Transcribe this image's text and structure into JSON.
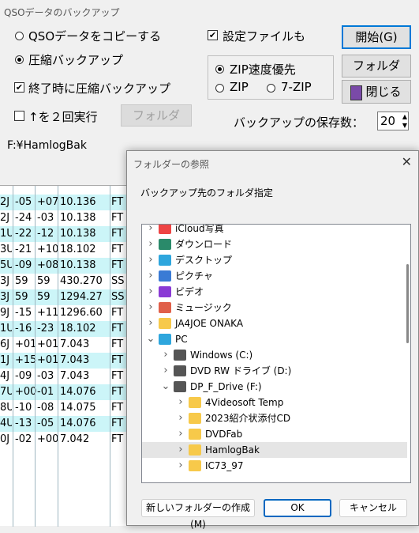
{
  "background_rows": [
    {
      "c1": "2J",
      "c2": "-05",
      "c3": "+07",
      "c4": "10.136",
      "c5": "FT"
    },
    {
      "c1": "2J",
      "c2": "-24",
      "c3": "-03",
      "c4": "10.138",
      "c5": "FT"
    },
    {
      "c1": "1U",
      "c2": "-22",
      "c3": "-12",
      "c4": "10.138",
      "c5": "FT"
    },
    {
      "c1": "3U",
      "c2": "-21",
      "c3": "+10",
      "c4": "18.102",
      "c5": "FT"
    },
    {
      "c1": "5U",
      "c2": "-09",
      "c3": "+08",
      "c4": "10.138",
      "c5": "FT"
    },
    {
      "c1": "3J",
      "c2": "59",
      "c3": "59",
      "c4": "430.270",
      "c5": "SS"
    },
    {
      "c1": "3J",
      "c2": "59",
      "c3": "59",
      "c4": "1294.27",
      "c5": "SS"
    },
    {
      "c1": "9J",
      "c2": "-15",
      "c3": "+11",
      "c4": "1296.60",
      "c5": "FT"
    },
    {
      "c1": "1U",
      "c2": "-16",
      "c3": "-23",
      "c4": "18.102",
      "c5": "FT"
    },
    {
      "c1": "6J",
      "c2": "+01",
      "c3": "+01",
      "c4": "7.043",
      "c5": "FT"
    },
    {
      "c1": "1J",
      "c2": "+15",
      "c3": "+01",
      "c4": "7.043",
      "c5": "FT"
    },
    {
      "c1": "4J",
      "c2": "-09",
      "c3": "-03",
      "c4": "7.043",
      "c5": "FT"
    },
    {
      "c1": "7U",
      "c2": "+00",
      "c3": "-01",
      "c4": "14.076",
      "c5": "FT"
    },
    {
      "c1": "8U",
      "c2": "-10",
      "c3": "-08",
      "c4": "14.075",
      "c5": "FT"
    },
    {
      "c1": "4U",
      "c2": "-13",
      "c3": "-05",
      "c4": "14.076",
      "c5": "FT"
    },
    {
      "c1": "0J",
      "c2": "-02",
      "c3": "+00",
      "c4": "7.042",
      "c5": "FT"
    }
  ],
  "backup": {
    "title": "QSOデータのバックアップ",
    "opt_copy": "QSOデータをコピーする",
    "opt_compress": "圧縮バックアップ",
    "chk_on_exit": "終了時に圧縮バックアップ",
    "chk_twice": "↑を２回実行",
    "btn_folder_disabled": "フォルダ",
    "path": "F:¥HamlogBak",
    "chk_settings": "設定ファイルも",
    "zip_speed": "ZIP速度優先",
    "zip": "ZIP",
    "sevenzip": "7-ZIP",
    "btn_start": "開始(G)",
    "btn_folder": "フォルダ",
    "btn_close": "閉じる",
    "save_count_label": "バックアップの保存数：",
    "save_count_value": "20"
  },
  "dialog": {
    "title": "フォルダーの参照",
    "message": "バックアップ先のフォルダ指定",
    "tree": [
      {
        "label": "iCloud写真",
        "icon": "icloud-photos-icon",
        "color": "#e44"
      },
      {
        "label": "ダウンロード",
        "icon": "download-icon",
        "color": "#2a8a6a"
      },
      {
        "label": "デスクトップ",
        "icon": "desktop-icon",
        "color": "#2ea6dd"
      },
      {
        "label": "ピクチャ",
        "icon": "pictures-icon",
        "color": "#3a7bd5"
      },
      {
        "label": "ビデオ",
        "icon": "video-icon",
        "color": "#8a3ad5"
      },
      {
        "label": "ミュージック",
        "icon": "music-icon",
        "color": "#e0604a"
      },
      {
        "label": "JA4JOE ONAKA",
        "icon": "folder-icon",
        "color": "#f7c94a"
      },
      {
        "label": "PC",
        "icon": "pc-icon",
        "color": "#2ea6dd"
      },
      {
        "label": "Windows (C:)",
        "icon": "drive-icon",
        "color": "#555"
      },
      {
        "label": "DVD RW ドライブ (D:)",
        "icon": "dvd-drive-icon",
        "color": "#555"
      },
      {
        "label": "DP_F_Drive (F:)",
        "icon": "drive-icon",
        "color": "#555"
      },
      {
        "label": "4Videosoft Temp",
        "icon": "folder-icon",
        "color": "#f7c94a"
      },
      {
        "label": "2023紹介状添付CD",
        "icon": "folder-icon",
        "color": "#f7c94a"
      },
      {
        "label": "DVDFab",
        "icon": "folder-icon",
        "color": "#f7c94a"
      },
      {
        "label": "HamlogBak",
        "icon": "folder-icon",
        "color": "#f7c94a"
      },
      {
        "label": "IC73_97",
        "icon": "folder-icon",
        "color": "#f7c94a"
      }
    ],
    "btn_new_folder": "新しいフォルダーの作成(M)",
    "btn_ok": "OK",
    "btn_cancel": "キャンセル"
  }
}
